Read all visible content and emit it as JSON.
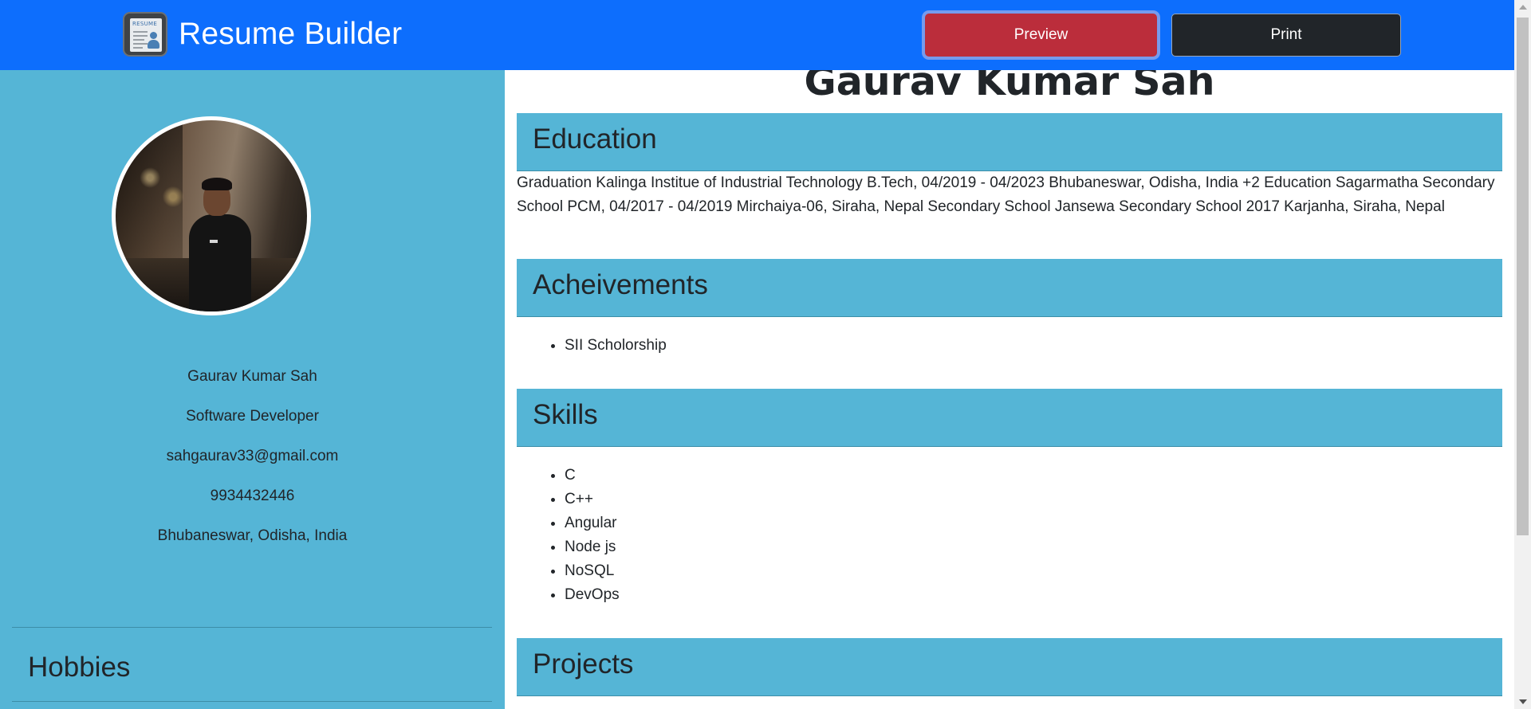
{
  "navbar": {
    "brand_title": "Resume Builder",
    "logo_text": "RESUME",
    "preview_label": "Preview",
    "print_label": "Print",
    "bg_color": "#0d6efd",
    "preview_color": "#bb2d3b",
    "print_color": "#212529"
  },
  "sidebar": {
    "bg_color": "#55b5d6",
    "name": "Gaurav Kumar Sah",
    "title": "Software Developer",
    "email": "sahgaurav33@gmail.com",
    "phone": "9934432446",
    "location": "Bhubaneswar, Odisha, India",
    "hobbies_title": "Hobbies"
  },
  "main": {
    "name": "Gaurav Kumar Sah",
    "education": {
      "title": "Education",
      "text": "Graduation Kalinga Institue of Industrial Technology B.Tech, 04/2019 - 04/2023 Bhubaneswar, Odisha, India +2 Education Sagarmatha Secondary School PCM, 04/2017 - 04/2019 Mirchaiya-06, Siraha, Nepal Secondary School Jansewa Secondary School 2017 Karjanha, Siraha, Nepal"
    },
    "achievements": {
      "title": "Acheivements",
      "items": [
        "SII Scholorship"
      ]
    },
    "skills": {
      "title": "Skills",
      "items": [
        "C",
        "C++",
        "Angular",
        "Node js",
        "NoSQL",
        "DevOps"
      ]
    },
    "projects": {
      "title": "Projects"
    }
  }
}
